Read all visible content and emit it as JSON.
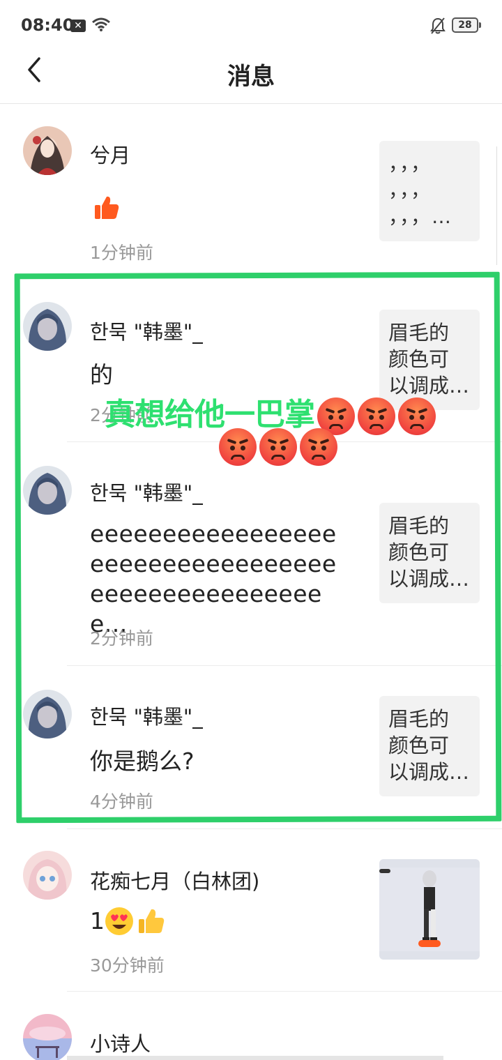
{
  "status": {
    "time": "08:40",
    "battery": "28"
  },
  "header": {
    "title": "消息"
  },
  "messages": [
    {
      "name": "兮月",
      "text": "",
      "time": "1分钟前",
      "thumb": "，，，\n，，，\n，，，…"
    },
    {
      "name": "한묵 \"韩墨\"_",
      "text": "的",
      "time": "2分钟前",
      "thumb": "眉毛的\n颜色可\n以调成…"
    },
    {
      "name": "한묵 \"韩墨\"_",
      "text": "eeeeeeeeeeeeeeeeeeeeeeeeeeeeeeeeeeeeeeeeeeeeeeeeeee...",
      "time": "2分钟前",
      "thumb": "眉毛的\n颜色可\n以调成…"
    },
    {
      "name": "한묵 \"韩墨\"_",
      "text": "你是鹅么?",
      "time": "4分钟前",
      "thumb": "眉毛的\n颜色可\n以调成…"
    },
    {
      "name": "花痴七月（白林团)",
      "text": "1",
      "time": "30分钟前",
      "thumb": ""
    },
    {
      "name": "小诗人",
      "text": "",
      "time": "",
      "thumb": ""
    }
  ],
  "overlay": {
    "text": "真想给他一巴掌"
  },
  "colors": {
    "accent_green": "#2ecf6a",
    "like_orange": "#ff5a1f",
    "time_gray": "#999999"
  },
  "icons": [
    "back-arrow-icon",
    "wifi-icon",
    "bell-off-icon",
    "thumbs-up-icon",
    "heart-eyes-emoji-icon",
    "angry-face-emoji-icon"
  ]
}
